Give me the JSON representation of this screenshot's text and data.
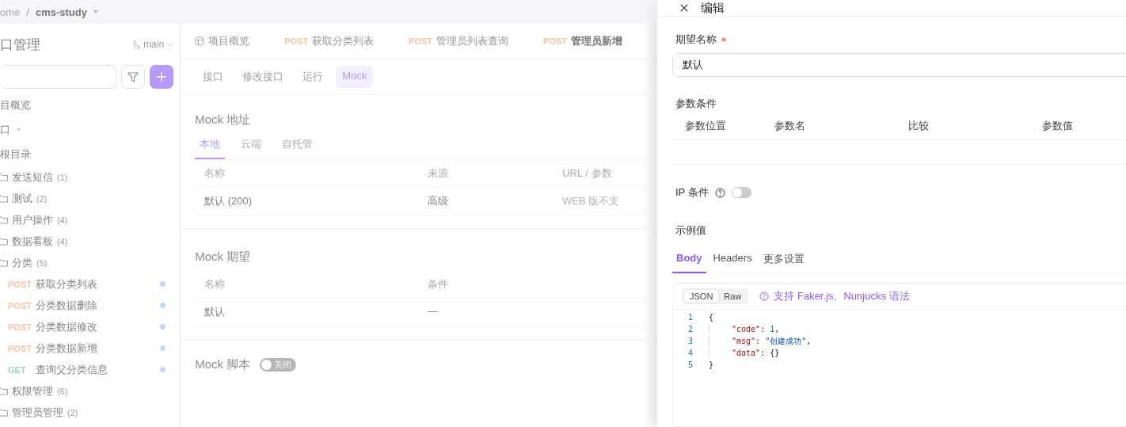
{
  "breadcrumb": [
    "ome",
    "/",
    "cms-study"
  ],
  "sidebar": {
    "title": "口管理",
    "branch": "main",
    "overview": "目概览",
    "group": "口",
    "tree": [
      {
        "kind": "root",
        "label": "根目录",
        "children": [
          {
            "kind": "folder",
            "label": "发送短信",
            "count": "(1)"
          },
          {
            "kind": "folder",
            "label": "测试",
            "count": "(2)"
          },
          {
            "kind": "folder",
            "label": "用户操作",
            "count": "(4)"
          },
          {
            "kind": "folder",
            "label": "数据看板",
            "count": "(4)"
          },
          {
            "kind": "folder",
            "label": "分类",
            "count": "(5)",
            "children": [
              {
                "kind": "api",
                "method": "POST",
                "label": "获取分类列表"
              },
              {
                "kind": "api",
                "method": "POST",
                "label": "分类数据删除"
              },
              {
                "kind": "api",
                "method": "POST",
                "label": "分类数据修改"
              },
              {
                "kind": "api",
                "method": "POST",
                "label": "分类数据新增"
              },
              {
                "kind": "api",
                "method": "GET",
                "label": "查询父分类信息"
              }
            ]
          },
          {
            "kind": "folder",
            "label": "权限管理",
            "count": "(6)"
          },
          {
            "kind": "folder",
            "label": "管理员管理",
            "count": "(2)"
          }
        ]
      }
    ]
  },
  "tabs": [
    {
      "kind": "overview",
      "label": "项目概览",
      "selected": false
    },
    {
      "kind": "api",
      "method": "POST",
      "label": "获取分类列表",
      "selected": false
    },
    {
      "kind": "api",
      "method": "POST",
      "label": "管理员列表查询",
      "selected": false
    },
    {
      "kind": "api",
      "method": "POST",
      "label": "管理员新增",
      "selected": true
    }
  ],
  "subtabs": [
    {
      "label": "接口",
      "selected": false
    },
    {
      "label": "修改接口",
      "selected": false
    },
    {
      "label": "运行",
      "selected": false
    },
    {
      "label": "Mock",
      "selected": true
    }
  ],
  "mock_address": {
    "title": "Mock 地址",
    "tabs": [
      {
        "label": "本地",
        "selected": true
      },
      {
        "label": "云端",
        "selected": false
      },
      {
        "label": "自托管",
        "selected": false
      }
    ],
    "columns": [
      "名称",
      "来源",
      "URL / 参数"
    ],
    "rows": [
      [
        "默认 (200)",
        "高级",
        "WEB 版不支"
      ]
    ]
  },
  "mock_expect": {
    "title": "Mock 期望",
    "columns": [
      "名称",
      "条件"
    ],
    "rows": [
      [
        "默认",
        "—"
      ]
    ]
  },
  "mock_script": {
    "title": "Mock 脚本",
    "toggle_label": "关闭",
    "on": false
  },
  "drawer": {
    "title": "编辑",
    "name_label": "期望名称",
    "required": true,
    "name_value": "默认",
    "params_title": "参数条件",
    "param_columns": [
      "参数位置",
      "参数名",
      "比较",
      "参数值"
    ],
    "ip_label": "IP 条件",
    "ip_on": false,
    "example_title": "示例值",
    "tabs": [
      {
        "label": "Body",
        "selected": true
      },
      {
        "label": "Headers",
        "selected": false
      },
      {
        "label": "更多设置",
        "selected": false
      }
    ],
    "formats": [
      {
        "label": "JSON",
        "selected": true
      },
      {
        "label": "Raw",
        "selected": false
      }
    ],
    "help": "支持 Faker.js、Nunjucks 语法",
    "code": [
      {
        "num": "1",
        "indented": false,
        "tokens": [
          {
            "kind": "punct",
            "text": "{"
          }
        ]
      },
      {
        "num": "2",
        "indented": true,
        "tokens": [
          {
            "kind": "key",
            "text": "\"code\""
          },
          {
            "kind": "punct",
            "text": ": "
          },
          {
            "kind": "num",
            "text": "1"
          },
          {
            "kind": "punct",
            "text": ","
          }
        ]
      },
      {
        "num": "3",
        "indented": true,
        "tokens": [
          {
            "kind": "key",
            "text": "\"msg\""
          },
          {
            "kind": "punct",
            "text": ": "
          },
          {
            "kind": "str",
            "text": "\"创建成功\""
          },
          {
            "kind": "punct",
            "text": ","
          }
        ]
      },
      {
        "num": "4",
        "indented": true,
        "tokens": [
          {
            "kind": "key",
            "text": "\"data\""
          },
          {
            "kind": "punct",
            "text": ": {}"
          }
        ]
      },
      {
        "num": "5",
        "indented": false,
        "tokens": [
          {
            "kind": "punct",
            "text": "}"
          }
        ]
      }
    ]
  }
}
